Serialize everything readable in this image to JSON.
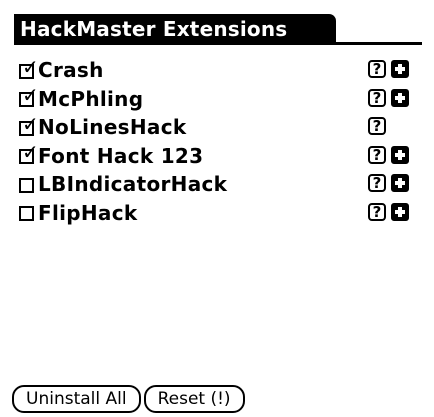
{
  "app": {
    "title": "HackMaster Extensions"
  },
  "hacks": [
    {
      "name": "Crash",
      "checked": true,
      "help_label": "?",
      "has_prefs": true
    },
    {
      "name": "McPhling",
      "checked": true,
      "help_label": "?",
      "has_prefs": true
    },
    {
      "name": "NoLinesHack",
      "checked": true,
      "help_label": "?",
      "has_prefs": false
    },
    {
      "name": "Font Hack 123",
      "checked": true,
      "help_label": "?",
      "has_prefs": true
    },
    {
      "name": "LBIndicatorHack",
      "checked": false,
      "help_label": "?",
      "has_prefs": true
    },
    {
      "name": "FlipHack",
      "checked": false,
      "help_label": "?",
      "has_prefs": true
    }
  ],
  "buttons": {
    "uninstall_all": "Uninstall All",
    "reset": "Reset (!)"
  },
  "icons": {
    "checkmark": "checkmark-icon",
    "help": "question-mark-icon",
    "prefs": "plus-icon"
  },
  "colors": {
    "foreground": "#000000",
    "background": "#ffffff"
  }
}
